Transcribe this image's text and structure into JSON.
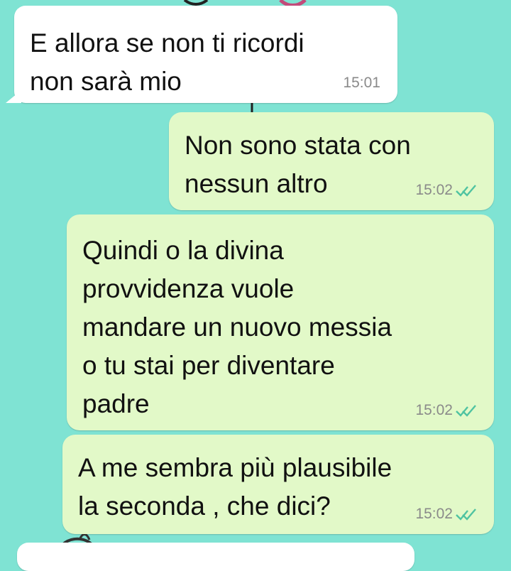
{
  "chat": {
    "messages": [
      {
        "direction": "incoming",
        "text": "E allora se non ti ricordi\nnon sarà mio",
        "time": "15:01"
      },
      {
        "direction": "outgoing",
        "text": "Non sono stata con\nnessun altro",
        "time": "15:02",
        "status": "read"
      },
      {
        "direction": "outgoing",
        "text": "Quindi o la divina\nprovvidenza vuole\nmandare un nuovo messia\no tu stai per diventare\npadre",
        "time": "15:02",
        "status": "read"
      },
      {
        "direction": "outgoing",
        "text": "A me sembra più plausibile\nla seconda , che dici?",
        "time": "15:02",
        "status": "read"
      }
    ]
  },
  "theme": {
    "wallpaper": "#7fe3d3",
    "incoming_bubble": "#ffffff",
    "outgoing_bubble": "#e2f9c8",
    "time_color": "#8a8a8a",
    "read_check_color": "#4fc3a1"
  }
}
